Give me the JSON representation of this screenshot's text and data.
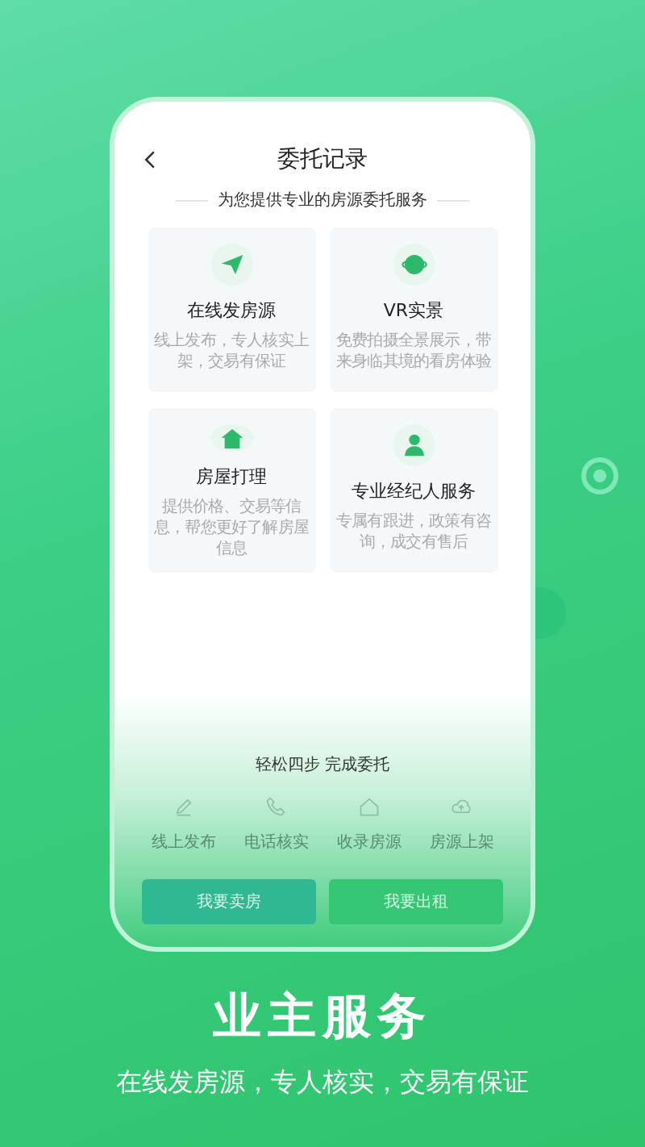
{
  "screen": {
    "title": "委托记录",
    "subtitle": "为您提供专业的房源委托服务",
    "services": [
      {
        "title": "在线发房源",
        "desc": "线上发布，专人核实上架，交易有保证"
      },
      {
        "title": "VR实景",
        "desc": "免费拍摄全景展示，带来身临其境的看房体验"
      },
      {
        "title": "房屋打理",
        "desc": "提供价格、交易等信息，帮您更好了解房屋信息"
      },
      {
        "title": "专业经纪人服务",
        "desc": "专属有跟进，政策有咨询，成交有售后"
      }
    ],
    "steps_title": "轻松四步 完成委托",
    "steps": [
      "线上发布",
      "电话核实",
      "收录房源",
      "房源上架"
    ],
    "buttons": [
      {
        "label": "我要卖房",
        "color": "#2fb892"
      },
      {
        "label": "我要出租",
        "color": "#36c774"
      }
    ]
  },
  "promo": {
    "title": "业主服务",
    "subtitle": "在线发房源，专人核实，交易有保证"
  }
}
